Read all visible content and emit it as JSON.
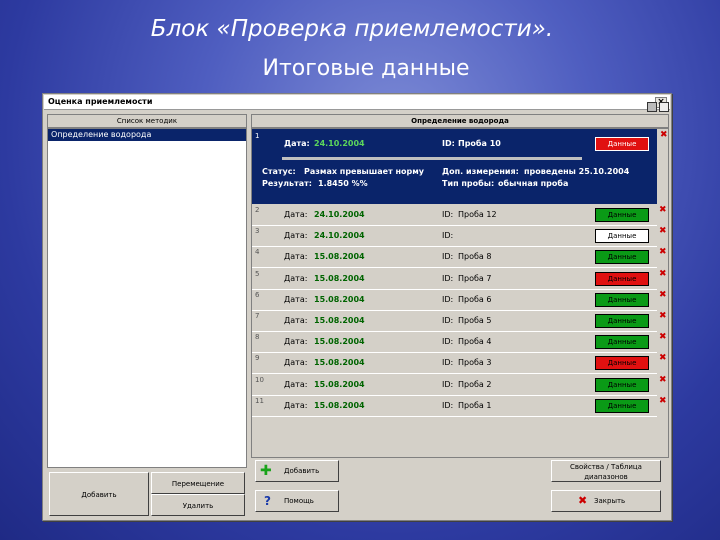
{
  "slide": {
    "title_line1": "Блок «Проверка приемлемости».",
    "title_line2": "Итоговые данные"
  },
  "window": {
    "title": "Оценка приемлемости",
    "close_label": "×"
  },
  "left": {
    "header": "Список методик",
    "items": [
      "Определение водорода"
    ],
    "add_label": "Добавить",
    "remeasure_label": "Перемещение",
    "delete_label": "Удалить"
  },
  "right": {
    "header": "Определение водорода",
    "selected": {
      "index": "1",
      "date_label": "Дата:",
      "date": "24.10.2004",
      "id_label": "ID:",
      "id": "Проба 10",
      "button": "Данные",
      "status_label": "Статус:",
      "status": "Размах превышает норму",
      "result_label": "Результат:",
      "result": "1.8450 %%",
      "extra_label": "Доп. измерения:",
      "extra": "проведены 25.10.2004",
      "type_label": "Тип пробы:",
      "type": "обычная проба"
    },
    "rows": [
      {
        "index": "2",
        "date_label": "Дата:",
        "date": "24.10.2004",
        "id_label": "ID:",
        "id": "Проба 12",
        "button": "Данные",
        "status": "green"
      },
      {
        "index": "3",
        "date_label": "Дата:",
        "date": "24.10.2004",
        "id_label": "ID:",
        "id": "",
        "button": "Данные",
        "status": "white"
      },
      {
        "index": "4",
        "date_label": "Дата:",
        "date": "15.08.2004",
        "id_label": "ID:",
        "id": "Проба 8",
        "button": "Данные",
        "status": "green"
      },
      {
        "index": "5",
        "date_label": "Дата:",
        "date": "15.08.2004",
        "id_label": "ID:",
        "id": "Проба 7",
        "button": "Данные",
        "status": "red"
      },
      {
        "index": "6",
        "date_label": "Дата:",
        "date": "15.08.2004",
        "id_label": "ID:",
        "id": "Проба 6",
        "button": "Данные",
        "status": "green"
      },
      {
        "index": "7",
        "date_label": "Дата:",
        "date": "15.08.2004",
        "id_label": "ID:",
        "id": "Проба 5",
        "button": "Данные",
        "status": "green"
      },
      {
        "index": "8",
        "date_label": "Дата:",
        "date": "15.08.2004",
        "id_label": "ID:",
        "id": "Проба 4",
        "button": "Данные",
        "status": "green"
      },
      {
        "index": "9",
        "date_label": "Дата:",
        "date": "15.08.2004",
        "id_label": "ID:",
        "id": "Проба 3",
        "button": "Данные",
        "status": "red"
      },
      {
        "index": "10",
        "date_label": "Дата:",
        "date": "15.08.2004",
        "id_label": "ID:",
        "id": "Проба 2",
        "button": "Данные",
        "status": "green"
      },
      {
        "index": "11",
        "date_label": "Дата:",
        "date": "15.08.2004",
        "id_label": "ID:",
        "id": "Проба 1",
        "button": "Данные",
        "status": "green"
      }
    ],
    "add_label": "Добавить",
    "props_label": "Свойства / Таблица диапазонов",
    "help_label": "Помощь",
    "close_label": "Закрыть"
  },
  "colors": {
    "green": "#0a9a16",
    "red": "#e01010",
    "white": "#ffffff",
    "selection": "#0a246a"
  }
}
